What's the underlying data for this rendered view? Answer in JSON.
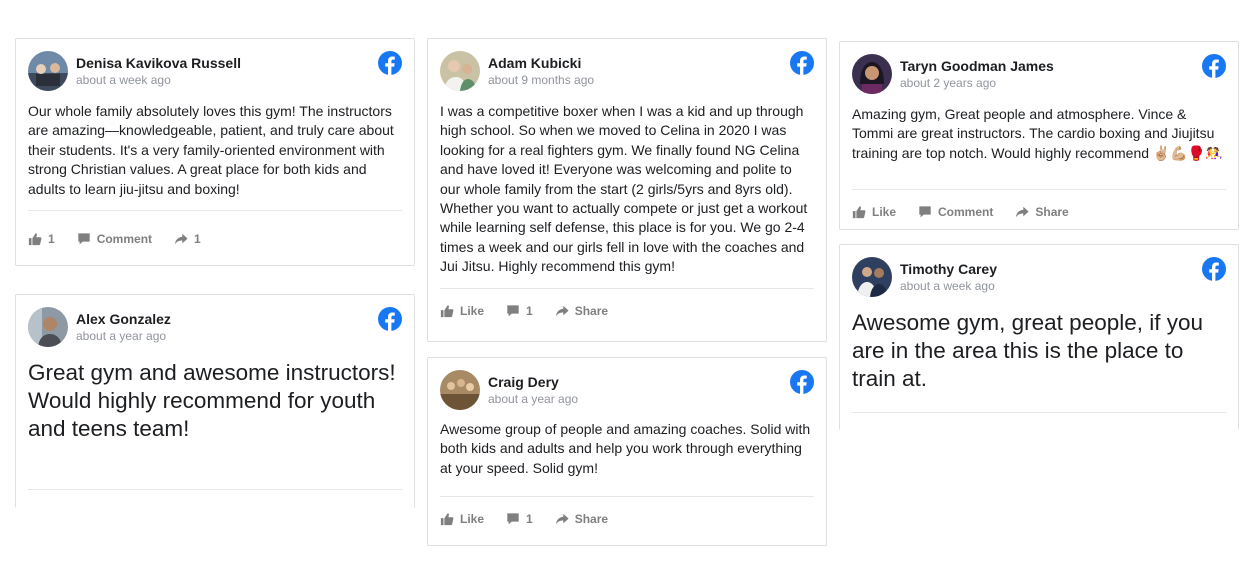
{
  "reviews": [
    {
      "name": "Denisa Kavikova Russell",
      "time": "about a week ago",
      "text": "Our whole family absolutely loves this gym! The instructors are amazing—knowledgeable, patient, and truly care about their students. It's a very family-oriented environment with strong Christian values. A great place for both kids and adults to learn jiu-jitsu and boxing!",
      "like_count": "1",
      "comment_label": "Comment",
      "share_count": "1"
    },
    {
      "name": "Alex Gonzalez",
      "time": "about a year ago",
      "text": "Great gym and awesome instructors! Would highly recommend for youth and teens team!"
    },
    {
      "name": "Adam Kubicki",
      "time": "about 9 months ago",
      "text": "I was a competitive boxer when I was a kid and up through high school. So when we moved to Celina in 2020 I was looking for a real fighters gym. We finally found NG Celina and have loved it! Everyone was welcoming and polite to our whole family from the start (2 girls/5yrs and 8yrs old). Whether you want to actually compete or just get a workout while learning self defense, this place is for you. We go 2-4 times a week and our girls fell in love with the coaches and Jui Jitsu. Highly recommend this gym!",
      "like_label": "Like",
      "comment_count": "1",
      "share_label": "Share"
    },
    {
      "name": "Craig Dery",
      "time": "about a year ago",
      "text": "Awesome group of people and amazing coaches. Solid with both kids and adults and help you work through everything at your speed. Solid gym!",
      "like_label": "Like",
      "comment_count": "1",
      "share_label": "Share"
    },
    {
      "name": "Taryn Goodman James",
      "time": "about 2 years ago",
      "text": "Amazing gym, Great people and atmosphere. Vince & Tommi are great instructors. The cardio boxing and Jiujitsu training are top notch. Would highly recommend ✌🏼💪🏼🥊🤼‍♀️",
      "like_label": "Like",
      "comment_label": "Comment",
      "share_label": "Share"
    },
    {
      "name": "Timothy Carey",
      "time": "about a week ago",
      "text": "Awesome gym, great people, if you are in the area this is the place to train at."
    }
  ],
  "colors": {
    "facebook_blue": "#1877f2",
    "action_gray": "#7f7f7f",
    "timestamp_gray": "#90949c"
  },
  "icons": {
    "source": "facebook-icon",
    "like": "thumbs-up-icon",
    "comment": "comment-bubble-icon",
    "share": "share-arrow-icon"
  }
}
